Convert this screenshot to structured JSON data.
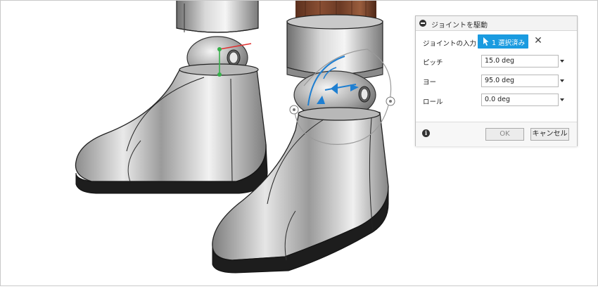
{
  "dialog": {
    "title": "ジョイントを駆動",
    "selection": {
      "label": "ジョイントの入力",
      "button_label": "1 選択済み"
    },
    "fields": [
      {
        "label": "ピッチ",
        "value": "15.0 deg"
      },
      {
        "label": "ヨー",
        "value": "95.0 deg"
      },
      {
        "label": "ロール",
        "value": "0.0 deg"
      }
    ],
    "ok_label": "OK",
    "cancel_label": "キャンセル"
  },
  "colors": {
    "accent": "#1a9be0",
    "manipulator": "#1f7fd1",
    "origin_green": "#36b04a",
    "origin_red": "#e0302f"
  },
  "icons": [
    "collapse-icon",
    "cursor-icon",
    "clear-icon",
    "info-icon",
    "dropdown-caret-icon"
  ]
}
